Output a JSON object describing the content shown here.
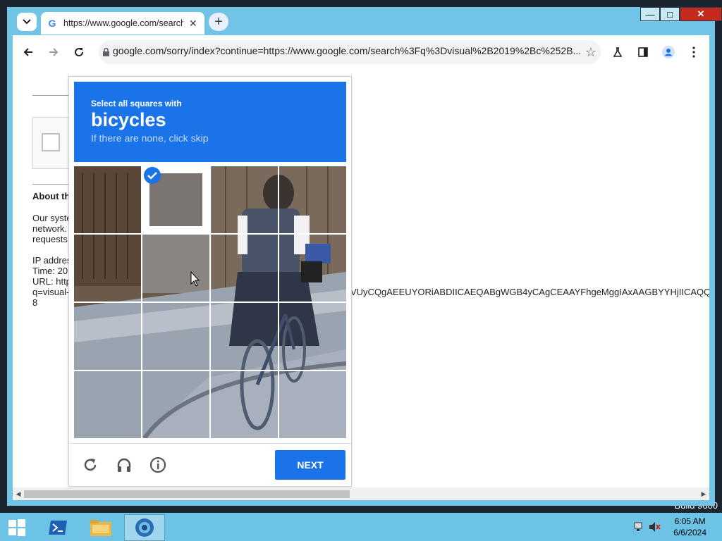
{
  "desktop": {
    "build_text": "Build 9600"
  },
  "browser": {
    "tab_title": "https://www.google.com/search",
    "url": "google.com/sorry/index?continue=https://www.google.com/search%3Fq%3Dvisual%2B2019%2Bc%252B...",
    "window_buttons": {
      "minimize": "—",
      "maximize": "□",
      "close": "✕"
    }
  },
  "page": {
    "about_heading": "About th",
    "paragraph_lines": [
      "Our syste",
      "network.",
      "requests"
    ],
    "ip_label": "IP addres",
    "time_label": "Time: 20",
    "url_label": "URL: http",
    "url_q": "q=visual-",
    "url_tail": "VUyCQgAEEUYORiABDIICAEQABgWGB4yCAgCEAAYFhgeMggIAxAAGBYYHjIICAQQ",
    "num_line": "8"
  },
  "captcha": {
    "select_text": "Select all squares with",
    "object": "bicycles",
    "skip_text": "If there are none, click skip",
    "next_label": "NEXT",
    "selected_cell": "row 1, column 2"
  },
  "taskbar": {
    "time": "6:05 AM",
    "date": "6/6/2024"
  }
}
